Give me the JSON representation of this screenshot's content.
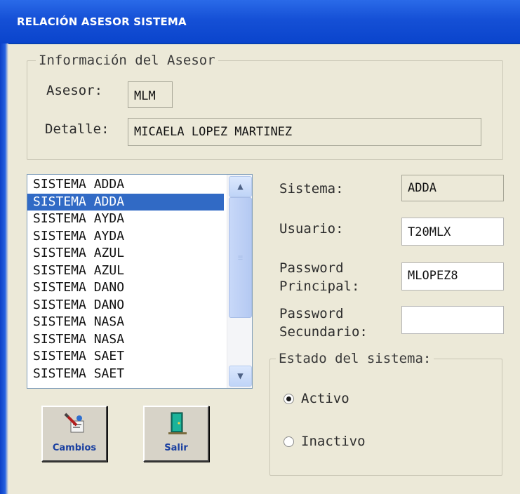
{
  "window": {
    "title": "RELACIÓN ASESOR SISTEMA"
  },
  "asesor_group": {
    "legend": "Información del Asesor",
    "asesor_label": "Asesor:",
    "asesor_value": "MLM",
    "detalle_label": "Detalle:",
    "detalle_value": "MICAELA LOPEZ MARTINEZ"
  },
  "systems_list": {
    "items": [
      {
        "label": "SISTEMA ADDA"
      },
      {
        "label": "SISTEMA ADDA"
      },
      {
        "label": "SISTEMA AYDA"
      },
      {
        "label": "SISTEMA AYDA"
      },
      {
        "label": "SISTEMA AZUL"
      },
      {
        "label": "SISTEMA AZUL"
      },
      {
        "label": "SISTEMA DANO"
      },
      {
        "label": "SISTEMA DANO"
      },
      {
        "label": "SISTEMA NASA"
      },
      {
        "label": "SISTEMA NASA"
      },
      {
        "label": "SISTEMA SAET"
      },
      {
        "label": "SISTEMA SAET"
      }
    ],
    "selected_index": 1
  },
  "form": {
    "sistema_label": "Sistema:",
    "sistema_value": "ADDA",
    "usuario_label": "Usuario:",
    "usuario_value": "T20MLX",
    "password_principal_label_1": "Password",
    "password_principal_label_2": "Principal:",
    "password_principal_value": "MLOPEZ8",
    "password_secundario_label_1": "Password",
    "password_secundario_label_2": "Secundario:",
    "password_secundario_value": ""
  },
  "estado": {
    "legend": "Estado del sistema:",
    "activo_label": "Activo",
    "inactivo_label": "Inactivo",
    "selected": "Activo"
  },
  "buttons": {
    "cambios_label": "Cambios",
    "salir_label": "Salir"
  },
  "icons": {
    "cambios": "edit-document-icon",
    "salir": "exit-door-icon"
  },
  "colors": {
    "titlebar": "#1550d6",
    "selection": "#316ac5",
    "background": "#ece9d8"
  }
}
